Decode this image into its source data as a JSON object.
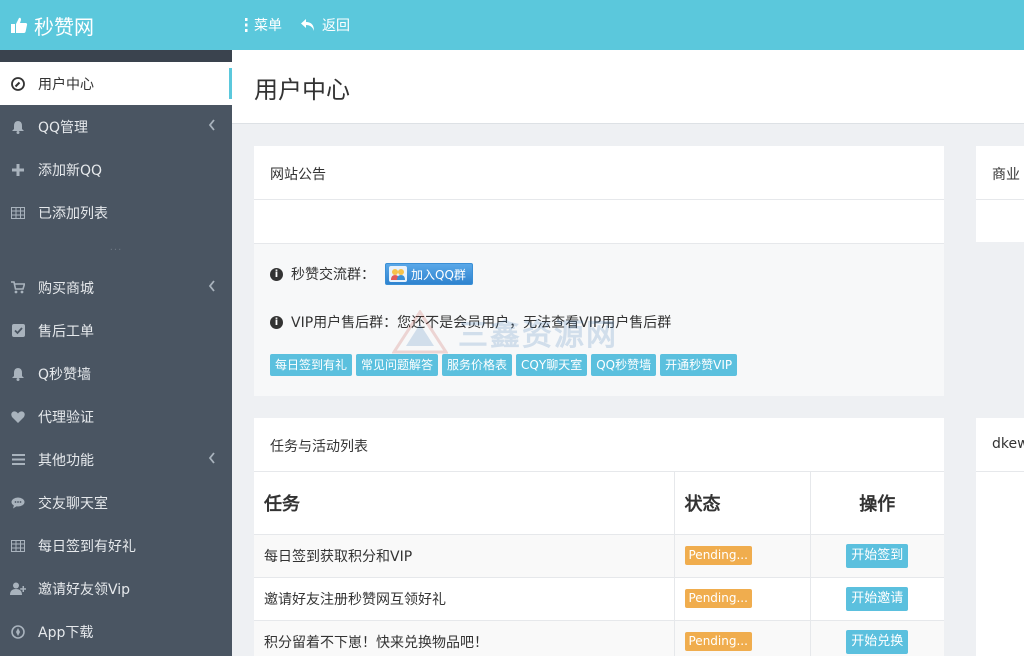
{
  "brand": {
    "name": "秒赞网",
    "icon": "thumbs-up-icon"
  },
  "topnav": {
    "menu_label": "菜单",
    "back_label": "返回"
  },
  "sidebar": {
    "items": [
      {
        "label": "用户中心",
        "icon": "dashboard-icon",
        "active": true,
        "chevron": false
      },
      {
        "label": "QQ管理",
        "icon": "bell-icon",
        "chevron": true
      },
      {
        "label": "添加新QQ",
        "icon": "plus-icon",
        "chevron": false
      },
      {
        "label": "已添加列表",
        "icon": "table-icon",
        "chevron": false
      },
      {
        "label": "购买商城",
        "icon": "cart-icon",
        "chevron": true
      },
      {
        "label": "售后工单",
        "icon": "checkbox-icon",
        "chevron": false
      },
      {
        "label": "Q秒赞墙",
        "icon": "bell-icon",
        "chevron": false
      },
      {
        "label": "代理验证",
        "icon": "heart-icon",
        "chevron": false
      },
      {
        "label": "其他功能",
        "icon": "list-icon",
        "chevron": true
      },
      {
        "label": "交友聊天室",
        "icon": "chat-icon",
        "chevron": false
      },
      {
        "label": "每日签到有好礼",
        "icon": "table-icon",
        "chevron": false
      },
      {
        "label": "邀请好友领Vip",
        "icon": "user-add-icon",
        "chevron": false
      },
      {
        "label": "App下载",
        "icon": "compass-icon",
        "chevron": false
      }
    ],
    "separator": "···"
  },
  "page": {
    "title": "用户中心"
  },
  "notice": {
    "title": "网站公告",
    "group_label": "秒赞交流群：",
    "qq_button": "加入QQ群",
    "vip_label": "VIP用户售后群：",
    "vip_text": "您还不是会员用户，无法查看VIP用户售后群",
    "tags": [
      "每日签到有礼",
      "常见问题解答",
      "服务价格表",
      "CQY聊天室",
      "QQ秒赞墙",
      "开通秒赞VIP"
    ]
  },
  "tasks": {
    "title": "任务与活动列表",
    "headers": {
      "task": "任务",
      "state": "状态",
      "op": "操作"
    },
    "rows": [
      {
        "task": "每日签到获取积分和VIP",
        "state": "Pending...",
        "op": "开始签到"
      },
      {
        "task": "邀请好友注册秒赞网互领好礼",
        "state": "Pending...",
        "op": "开始邀请"
      },
      {
        "task": "积分留着不下崽！快来兑换物品吧！",
        "state": "Pending...",
        "op": "开始兑换"
      }
    ]
  },
  "right": {
    "card1_title": "商业",
    "card2_title": "dkew"
  },
  "watermark": {
    "text": "三鑫资源网"
  },
  "colors": {
    "accent": "#5bc8dc",
    "sidebar": "#4a5562",
    "pending": "#f0ad4e",
    "info": "#5bc0de"
  }
}
